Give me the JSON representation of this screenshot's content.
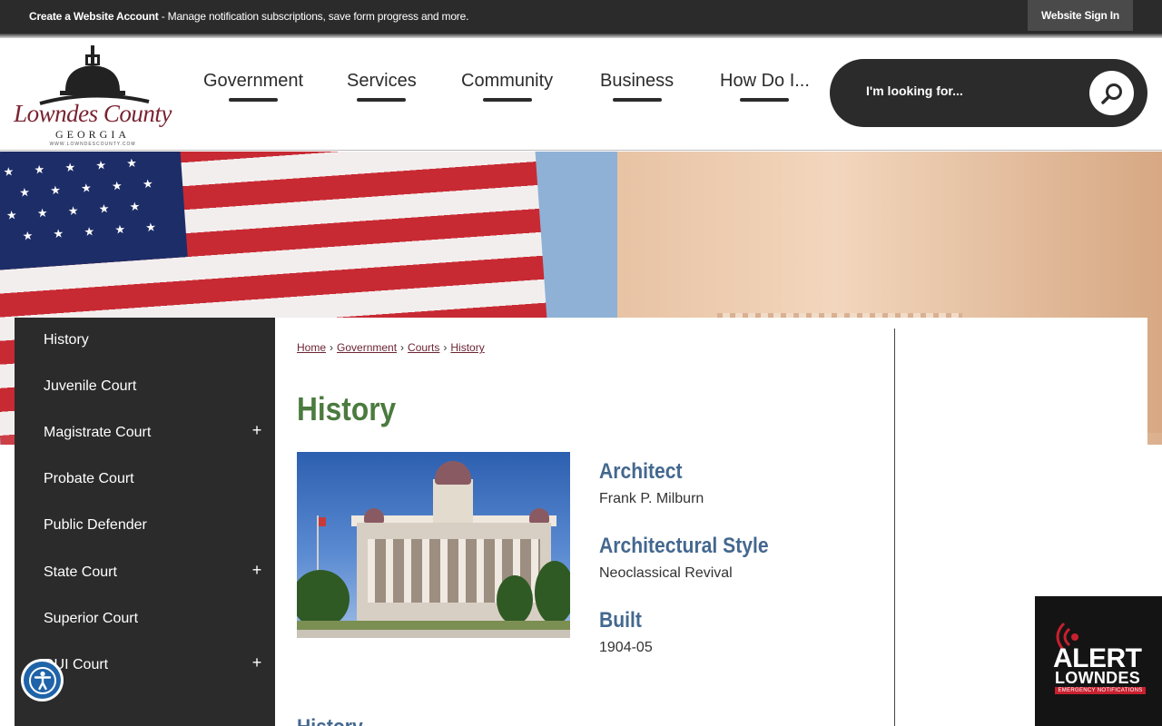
{
  "topbar": {
    "account_link": "Create a Website Account",
    "account_desc": " - Manage notification subscriptions, save form progress and more.",
    "signin_label": "Website Sign In"
  },
  "logo": {
    "script": "Lowndes County",
    "state": "GEORGIA",
    "url": "WWW.LOWNDESCOUNTY.COM"
  },
  "nav": {
    "items": [
      "Government",
      "Services",
      "Community",
      "Business",
      "How Do I..."
    ]
  },
  "search": {
    "placeholder": "I'm looking for..."
  },
  "sidebar": {
    "items": [
      {
        "label": "History",
        "expandable": false
      },
      {
        "label": "Juvenile Court",
        "expandable": false
      },
      {
        "label": "Magistrate Court",
        "expandable": true
      },
      {
        "label": "Probate Court",
        "expandable": false
      },
      {
        "label": "Public Defender",
        "expandable": false
      },
      {
        "label": "State Court",
        "expandable": true
      },
      {
        "label": "Superior Court",
        "expandable": false
      },
      {
        "label": "DUI Court",
        "expandable": true
      }
    ],
    "expand_symbol": "+"
  },
  "breadcrumb": {
    "items": [
      "Home",
      "Government",
      "Courts",
      "History"
    ],
    "separator": "›"
  },
  "page": {
    "title": "History",
    "facts": [
      {
        "label": "Architect",
        "value": "Frank P. Milburn"
      },
      {
        "label": "Architectural Style",
        "value": "Neoclassical Revival"
      },
      {
        "label": "Built",
        "value": "1904-05"
      }
    ],
    "subhead": "History"
  },
  "alert": {
    "title": "ALERT",
    "subtitle": "LOWNDES",
    "tagline": "EMERGENCY NOTIFICATIONS"
  },
  "colors": {
    "dark": "#2b2b2b",
    "title_green": "#4b7b3f",
    "heading_blue": "#44688f",
    "link_maroon": "#6b2432",
    "accessibility_blue": "#1f63a8",
    "alert_red": "#c7202f"
  },
  "icons": {
    "search": "search-icon",
    "accessibility": "accessibility-icon",
    "alert": "radio-waves-icon"
  }
}
